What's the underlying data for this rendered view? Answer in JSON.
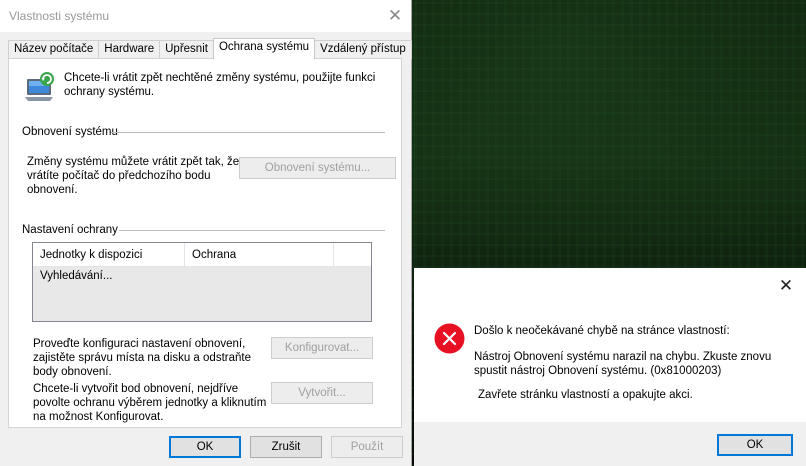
{
  "window": {
    "title": "Vlastnosti systému",
    "close_glyph": "✕"
  },
  "tabs": [
    {
      "label": "Název počítače",
      "active": false
    },
    {
      "label": "Hardware",
      "active": false
    },
    {
      "label": "Upřesnit",
      "active": false
    },
    {
      "label": "Ochrana systému",
      "active": true
    },
    {
      "label": "Vzdálený přístup",
      "active": false
    }
  ],
  "intro": {
    "icon": "system-protection-icon",
    "text": "Chcete-li vrátit zpět nechtěné změny systému, použijte funkci ochrany systému."
  },
  "restore": {
    "group_title": "Obnovení systému",
    "description": "Změny systému můžete vrátit zpět tak, že vrátíte počítač do předchozího bodu obnovení.",
    "button_label": "Obnovení systému..."
  },
  "protection": {
    "group_title": "Nastavení ochrany",
    "columns": [
      "Jednotky k dispozici",
      "Ochrana"
    ],
    "rows": [
      "Vyhledávání..."
    ],
    "configure_text": "Proveďte konfiguraci nastavení obnovení, zajistěte správu místa na disku a odstraňte body obnovení.",
    "configure_button": "Konfigurovat...",
    "create_text": "Chcete-li vytvořit bod obnovení, nejdříve povolte ochranu výběrem jednotky a kliknutím na možnost Konfigurovat.",
    "create_button": "Vytvořit..."
  },
  "footer": {
    "ok": "OK",
    "cancel": "Zrušit",
    "apply": "Použít"
  },
  "error_dialog": {
    "close_glyph": "✕",
    "icon": "error-icon",
    "heading": "Došlo k neočekávané chybě na stránce vlastností:",
    "message": "Nástroj Obnovení systému narazil na chybu. Zkuste znovu spustit nástroj Obnovení systému. (0x81000203)",
    "advice": "Zavřete stránku vlastností a opakujte akci.",
    "ok": "OK",
    "error_color": "#e81123",
    "accent_color": "#0078d7"
  }
}
